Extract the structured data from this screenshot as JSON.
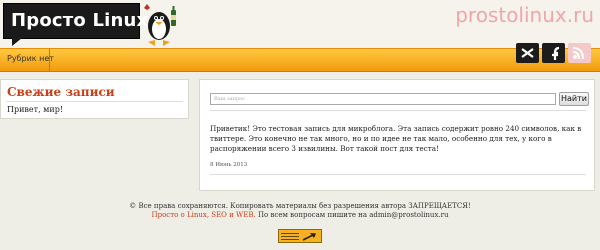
{
  "header": {
    "logo_text": "Просто Linux",
    "site_name": "prostolinux.ru"
  },
  "nav": {
    "items": [
      {
        "label": "Рубрик нет"
      }
    ]
  },
  "social": {
    "icons": [
      "twitter-icon",
      "facebook-icon",
      "rss-icon"
    ]
  },
  "sidebar": {
    "title": "Свежие записи",
    "items": [
      {
        "label": "Привет, мир!"
      }
    ]
  },
  "search": {
    "placeholder": "Ваш запрос",
    "button_label": "Найти"
  },
  "post": {
    "text": "Приветик! Это тестовая запись для микроблога. Эта запись содержит ровно 240 символов, как в твиттере. Это конечно не так много, но и по идее не так мало, особенно для тех, у кого в распоряжении всего 3 извилины. Вот такой пост для теста!",
    "date": "8 Июнь 2013"
  },
  "footer": {
    "line1": "© Все права сохраняются. Копировать материалы без разрешения автора ЗАПРЕЩАЕТСЯ!",
    "link_text": "Просто о Linux, SEO и WEB.",
    "line2_rest": " По всем вопросам пишите на admin@prostolinux.ru"
  },
  "colors": {
    "accent": "#c8401a",
    "nav_orange": "#f5a623",
    "background": "#eeede6"
  }
}
